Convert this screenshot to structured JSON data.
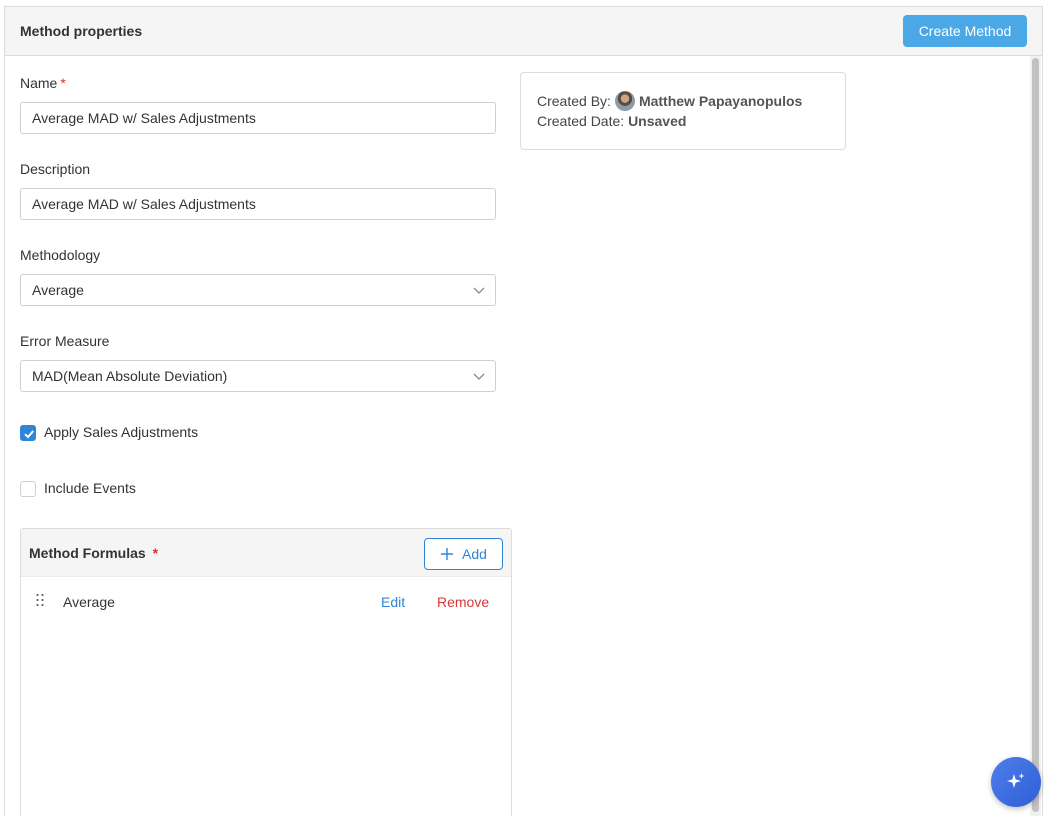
{
  "header": {
    "title": "Method properties",
    "create_label": "Create Method"
  },
  "form": {
    "name_label": "Name",
    "name_value": "Average MAD w/ Sales Adjustments",
    "description_label": "Description",
    "description_value": "Average MAD w/ Sales Adjustments",
    "methodology_label": "Methodology",
    "methodology_value": "Average",
    "error_measure_label": "Error Measure",
    "error_measure_value": "MAD(Mean Absolute Deviation)",
    "required_mark": "*",
    "apply_sales_label": "Apply Sales Adjustments",
    "apply_sales_checked": true,
    "include_events_label": "Include Events",
    "include_events_checked": false
  },
  "info": {
    "created_by_label": "Created By:",
    "created_by_value": "Matthew Papayanopulos",
    "created_date_label": "Created Date:",
    "created_date_value": "Unsaved"
  },
  "formulas": {
    "title": "Method Formulas",
    "required_mark": "*",
    "add_label": "Add",
    "items": [
      {
        "name": "Average",
        "edit_label": "Edit",
        "remove_label": "Remove"
      }
    ]
  },
  "icons": {
    "chevron": "chevron-down-icon",
    "check": "check-icon",
    "plus": "plus-icon",
    "drag": "drag-handle-icon",
    "sparkle": "sparkle-icon"
  },
  "colors": {
    "primary": "#4ba8e6",
    "link": "#2f86d4",
    "danger": "#d03b3b",
    "required": "#d9342b"
  }
}
